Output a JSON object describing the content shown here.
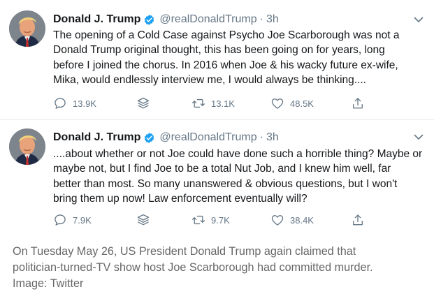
{
  "tweets": [
    {
      "display_name": "Donald J. Trump",
      "handle": "@realDonaldTrump",
      "separator": "·",
      "time": "3h",
      "lines": [
        "The opening of a Cold Case against Psycho Joe Scarborough was not a",
        "Donald Trump original thought, this has been going on for years, long",
        "before I joined the chorus. In 2016 when Joe & his wacky future ex-wife,",
        "Mika, would endlessly interview me, I would always be thinking...."
      ],
      "replies": "13.9K",
      "retweets": "13.1K",
      "likes": "48.5K"
    },
    {
      "display_name": "Donald J. Trump",
      "handle": "@realDonaldTrump",
      "separator": "·",
      "time": "3h",
      "lines": [
        "....about whether or not Joe could have done such a horrible thing? Maybe or",
        "maybe not, but I find Joe to be a total Nut Job, and I knew him well, far",
        "better than most. So many unanswered & obvious questions, but I won't",
        "bring them up now! Law enforcement eventually will?"
      ],
      "replies": "7.9K",
      "retweets": "9.7K",
      "likes": "38.4K"
    }
  ],
  "caption": {
    "lines": [
      "On Tuesday May 26, US President Donald Trump again claimed that",
      "politician-turned-TV show host Joe Scarborough had committed murder.",
      "Image: Twitter"
    ]
  },
  "colors": {
    "verified_blue": "#1da1f2",
    "secondary_text": "#657786",
    "caption_text": "#666666"
  },
  "icons": [
    "verified-badge-icon",
    "chevron-down-icon",
    "reply-icon",
    "layers-icon",
    "retweet-icon",
    "like-icon",
    "share-icon"
  ]
}
